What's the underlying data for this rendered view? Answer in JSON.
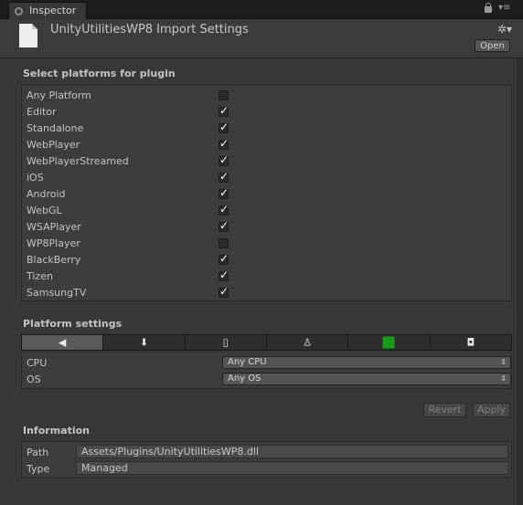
{
  "window": {
    "tab_label": "Inspector"
  },
  "header": {
    "title": "UnityUtilitiesWP8 Import Settings",
    "open_label": "Open"
  },
  "platforms": {
    "title": "Select platforms for plugin",
    "items": [
      {
        "label": "Any Platform",
        "checked": false
      },
      {
        "label": "Editor",
        "checked": true
      },
      {
        "label": "Standalone",
        "checked": true
      },
      {
        "label": "WebPlayer",
        "checked": true
      },
      {
        "label": "WebPlayerStreamed",
        "checked": true
      },
      {
        "label": "iOS",
        "checked": true
      },
      {
        "label": "Android",
        "checked": true
      },
      {
        "label": "WebGL",
        "checked": true
      },
      {
        "label": "WSAPlayer",
        "checked": true
      },
      {
        "label": "WP8Player",
        "checked": false
      },
      {
        "label": "BlackBerry",
        "checked": true
      },
      {
        "label": "Tizen",
        "checked": true
      },
      {
        "label": "SamsungTV",
        "checked": true
      }
    ]
  },
  "platform_settings": {
    "title": "Platform settings",
    "tabs": [
      {
        "icon": "unity-editor-icon",
        "active": true
      },
      {
        "icon": "standalone-download-icon",
        "active": false
      },
      {
        "icon": "mobile-device-icon",
        "active": false
      },
      {
        "icon": "android-icon",
        "active": false
      },
      {
        "icon": "windows-store-icon",
        "active": false
      },
      {
        "icon": "box-package-icon",
        "active": false
      }
    ],
    "cpu_label": "CPU",
    "cpu_value": "Any CPU",
    "os_label": "OS",
    "os_value": "Any OS"
  },
  "actions": {
    "revert_label": "Revert",
    "apply_label": "Apply"
  },
  "information": {
    "title": "Information",
    "path_label": "Path",
    "path_value": "Assets/Plugins/UnityUtilitiesWP8.dll",
    "type_label": "Type",
    "type_value": "Managed"
  }
}
